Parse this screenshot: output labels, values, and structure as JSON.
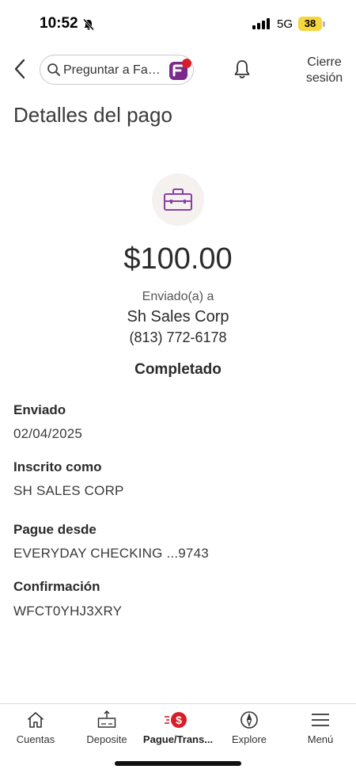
{
  "status_bar": {
    "time": "10:52",
    "network": "5G",
    "battery": "38"
  },
  "header": {
    "search_placeholder": "Preguntar a Fa…",
    "logout_line1": "Cierre",
    "logout_line2": "sesión"
  },
  "page": {
    "title": "Detalles del pago"
  },
  "payment": {
    "amount": "$100.00",
    "sent_to_label": "Enviado(a) a",
    "payee_name": "Sh Sales Corp",
    "payee_phone": "(813) 772-6178",
    "status": "Completado"
  },
  "details": [
    {
      "label": "Enviado",
      "value": "02/04/2025"
    },
    {
      "label": "Inscrito como",
      "value": "SH SALES CORP"
    },
    {
      "label": "Pague desde",
      "value": "EVERYDAY CHECKING ...9743"
    },
    {
      "label": "Confirmación",
      "value": "WFCT0YHJ3XRY"
    }
  ],
  "bottom_nav": [
    {
      "label": "Cuentas",
      "icon": "home-icon",
      "active": false
    },
    {
      "label": "Deposite",
      "icon": "deposit-icon",
      "active": false
    },
    {
      "label": "Pague/Trans...",
      "icon": "pay-transfer-icon",
      "active": true
    },
    {
      "label": "Explore",
      "icon": "compass-icon",
      "active": false
    },
    {
      "label": "Menú",
      "icon": "menu-icon",
      "active": false
    }
  ],
  "colors": {
    "accent_red": "#d71e28",
    "briefcase_purple": "#8a3fa8",
    "battery_yellow": "#f5d63d"
  }
}
